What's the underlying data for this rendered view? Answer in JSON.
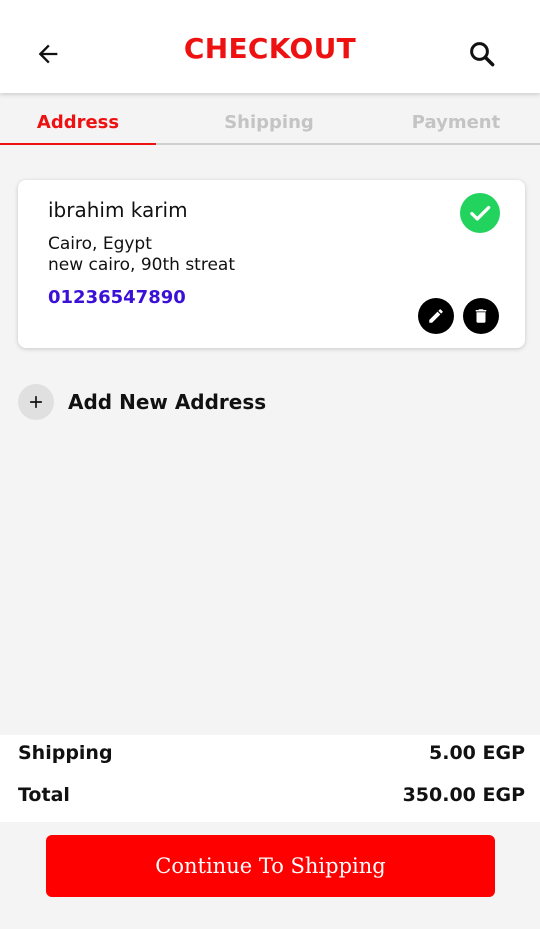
{
  "header": {
    "title": "CHECKOUT",
    "back_icon": "arrow-left-icon",
    "search_icon": "search-icon"
  },
  "tabs": [
    {
      "label": "Address",
      "state": "active"
    },
    {
      "label": "Shipping",
      "state": "inactive"
    },
    {
      "label": "Payment",
      "state": "inactive"
    }
  ],
  "address_card": {
    "name": "ibrahim karim",
    "line1": "Cairo, Egypt",
    "line2": "new cairo, 90th streat",
    "phone": "01236547890",
    "selected": true,
    "icons": {
      "selected": "check-circle-icon",
      "edit": "pencil-icon",
      "delete": "trash-icon"
    }
  },
  "add_address": {
    "label": "Add New Address",
    "icon": "plus-icon"
  },
  "summary": {
    "shipping_label": "Shipping",
    "shipping_value": "5.00 EGP",
    "total_label": "Total",
    "total_value": "350.00 EGP"
  },
  "cta": {
    "label": "Continue To Shipping"
  },
  "colors": {
    "accent": "#ee1111",
    "tab_inactive": "#c4c4c4",
    "phone": "#3b10d6",
    "check": "#22d35e",
    "button": "#fe0000"
  }
}
